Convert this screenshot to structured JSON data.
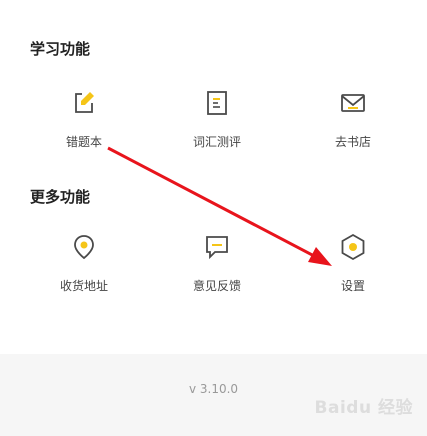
{
  "sections": {
    "learning": {
      "title": "学习功能",
      "items": [
        {
          "label": "错题本",
          "icon": "edit-note-icon"
        },
        {
          "label": "词汇测评",
          "icon": "document-list-icon"
        },
        {
          "label": "去书店",
          "icon": "envelope-icon"
        }
      ]
    },
    "more": {
      "title": "更多功能",
      "items": [
        {
          "label": "收货地址",
          "icon": "location-pin-icon"
        },
        {
          "label": "意见反馈",
          "icon": "feedback-message-icon"
        },
        {
          "label": "设置",
          "icon": "settings-hexagon-icon"
        }
      ]
    }
  },
  "footer": {
    "version": "v 3.10.0"
  },
  "watermark": {
    "text": "Baidu 经验"
  },
  "colors": {
    "accent": "#f5c518",
    "icon_stroke": "#4a4a4a",
    "arrow": "#e8141c",
    "footer_bg": "#f6f6f6"
  }
}
